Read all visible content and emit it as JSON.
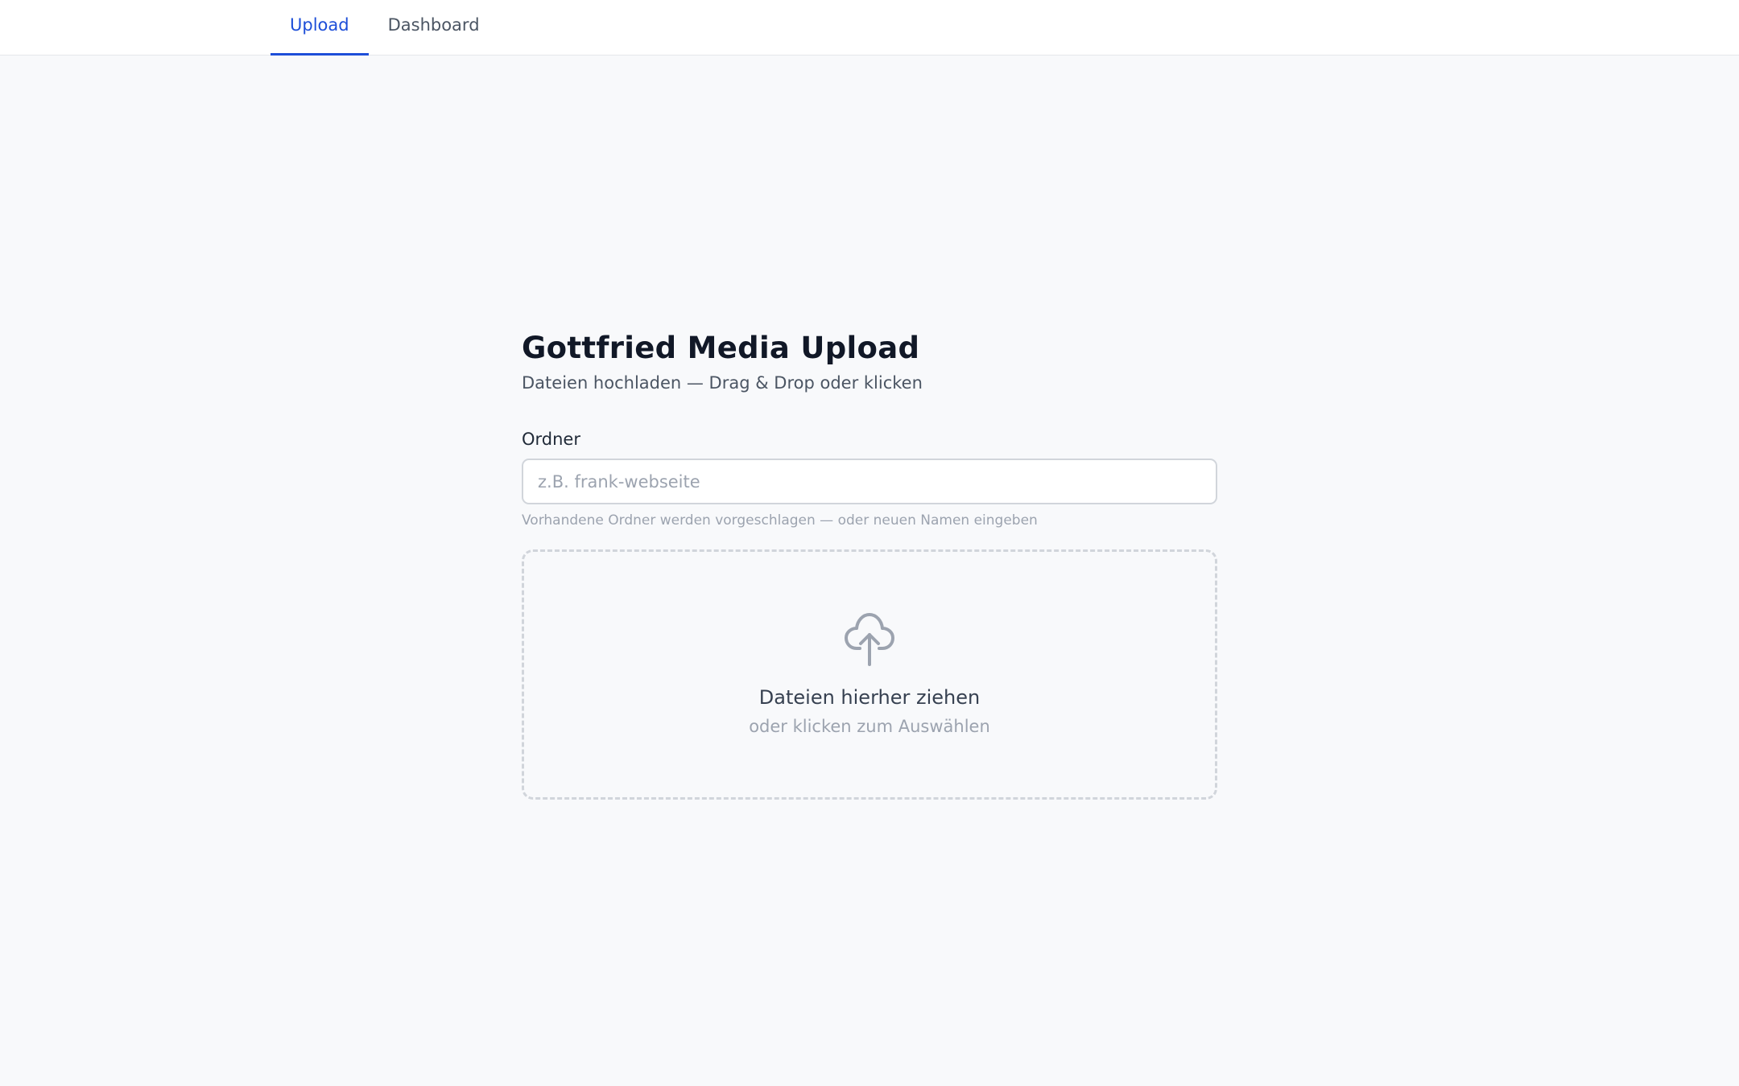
{
  "nav": {
    "tabs": [
      {
        "label": "Upload",
        "active": true
      },
      {
        "label": "Dashboard",
        "active": false
      }
    ],
    "accent_color": "#1d4ed8"
  },
  "main": {
    "title": "Gottfried Media Upload",
    "subtitle": "Dateien hochladen — Drag & Drop oder klicken",
    "folder": {
      "label": "Ordner",
      "value": "",
      "placeholder": "z.B. frank-webseite",
      "hint": "Vorhandene Ordner werden vorgeschlagen — oder neuen Namen eingeben"
    },
    "dropzone": {
      "icon": "cloud-upload-icon",
      "title": "Dateien hierher ziehen",
      "subtitle": "oder klicken zum Auswählen"
    }
  }
}
